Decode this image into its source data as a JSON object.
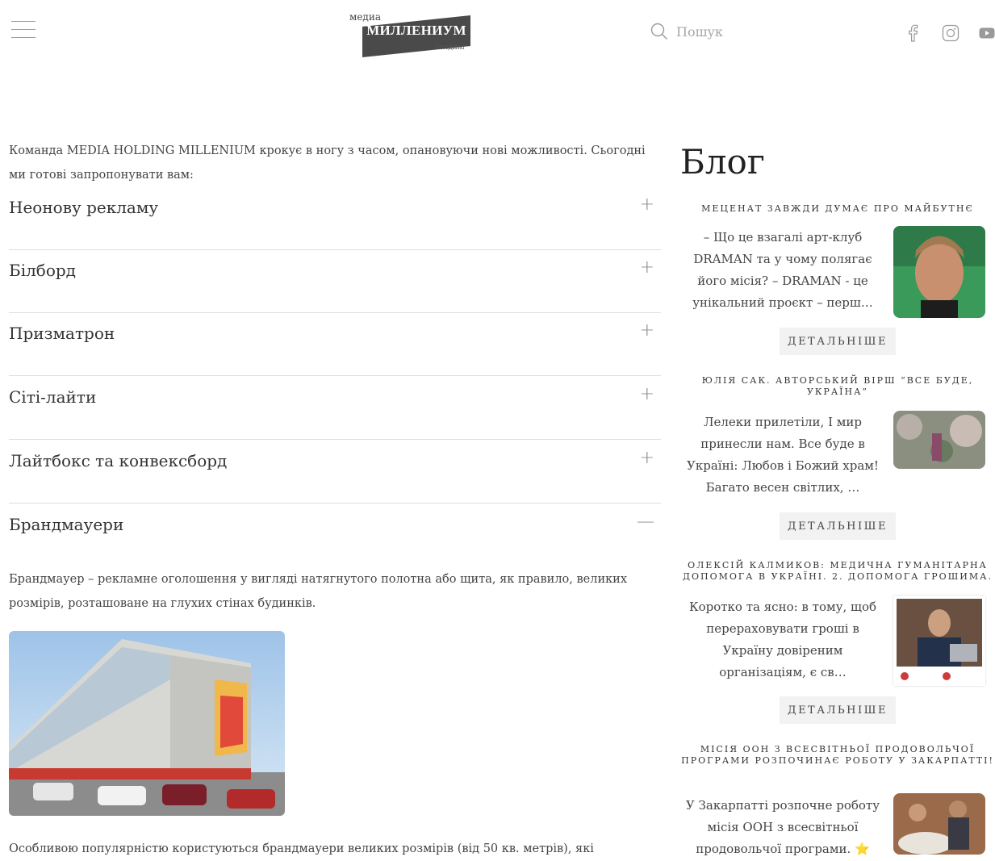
{
  "header": {
    "logo_top": "медиа",
    "logo_main": "МИЛЛЕНИУМ",
    "logo_bottom": "холдинг",
    "search_placeholder": "Пошук"
  },
  "intro_text": "Команда MEDIA HOLDING MILLENIUM крокує в ногу з часом, опановуючи нові можливості. Сьогодні ми готові запропонувати вам:",
  "accordion": [
    {
      "title": "Неонову рекламу",
      "sign": "+"
    },
    {
      "title": "Білборд",
      "sign": "+"
    },
    {
      "title": "Призматрон",
      "sign": "+"
    },
    {
      "title": "Сіті-лайти",
      "sign": "+"
    },
    {
      "title": "Лайтбокс та конвексборд",
      "sign": "+"
    },
    {
      "title": "Брандмауери",
      "sign": "—"
    }
  ],
  "open_body": "Брандмауер – рекламне оголошення у вигляді натягнутого полотна або щита, як правило, великих розмірів, розташоване на глухих стінах будинків.",
  "bottom_text": "Особливою популярністю користуються брандмауери великих розмірів (від 50 кв. метрів), які",
  "blog": {
    "title": "Блог",
    "more_label": "ДЕТАЛЬНІШЕ",
    "posts": [
      {
        "title": "МЕЦЕНАТ ЗАВЖДИ ДУМАЄ ПРО МАЙБУТНЄ",
        "excerpt": "– Що це взагалі арт-клуб DRAMAN та у чому полягає його місія? – DRAMAN - це унікальний проєкт – перш…"
      },
      {
        "title": "ЮЛІЯ САК. АВТОРСЬКИЙ ВІРШ “ВСЕ БУДЕ, УКРАЇНА”",
        "excerpt": "Лелеки прилетіли, І мир принесли нам. Все буде в Україні: Любов і Божий храм! Багато весен світлих, …"
      },
      {
        "title": "ОЛЕКСІЙ КАЛМИКОВ: МЕДИЧНА ГУМАНІТАРНА ДОПОМОГА В УКРАЇНІ. 2. ДОПОМОГА ГРОШИМА.",
        "excerpt": "Коротко та ясно: в тому, щоб перераховувати гроші в Україну довіреним організаціям, є св…"
      },
      {
        "title": "МІСІЯ ООН З ВСЕСВІТНЬОЇ ПРОДОВОЛЬЧОЇ ПРОГРАМИ РОЗПОЧИНАЄ РОБОТУ У ЗАКАРПАТТІ!",
        "excerpt": "У Закарпатті розпочне роботу місія ООН з всесвітньої продовольчої програми. ⭐"
      }
    ]
  },
  "icons": [
    "menu-icon",
    "search-icon",
    "facebook-icon",
    "instagram-icon",
    "youtube-icon"
  ]
}
